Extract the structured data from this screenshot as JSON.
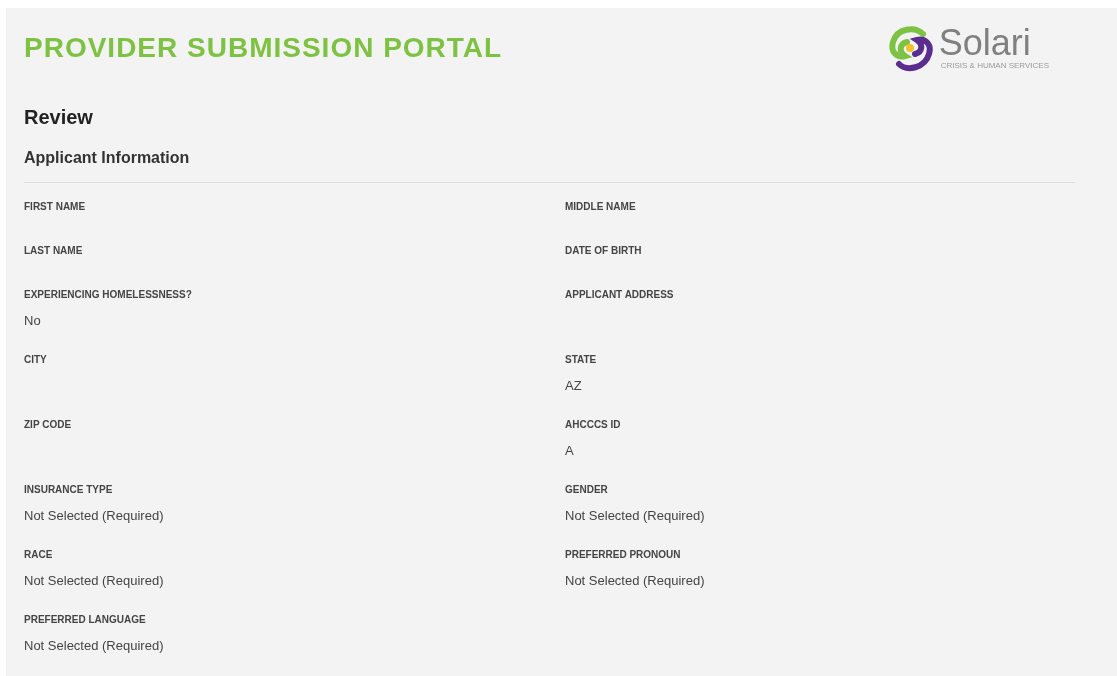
{
  "header": {
    "title": "PROVIDER SUBMISSION PORTAL",
    "logo": {
      "name": "Solari",
      "tagline": "CRISIS & HUMAN SERVICES"
    }
  },
  "page_title": "Review",
  "section": {
    "title": "Applicant Information",
    "rows": [
      [
        {
          "label": "FIRST NAME"
        },
        {
          "label": "MIDDLE NAME"
        }
      ],
      [
        {
          "label": "LAST NAME"
        },
        {
          "label": "DATE OF BIRTH"
        }
      ],
      [
        {
          "label": "EXPERIENCING HOMELESSNESS?",
          "value": "No"
        },
        {
          "label": "APPLICANT ADDRESS"
        }
      ],
      [
        {
          "label": "CITY"
        },
        {
          "label": "STATE",
          "value": "AZ"
        }
      ],
      [
        {
          "label": "ZIP CODE"
        },
        {
          "label": "AHCCCS ID",
          "value": "A"
        }
      ],
      [
        {
          "label": "INSURANCE TYPE",
          "value": "Not Selected (Required)"
        },
        {
          "label": "GENDER",
          "value": "Not Selected (Required)"
        }
      ],
      [
        {
          "label": "RACE",
          "value": "Not Selected (Required)"
        },
        {
          "label": "PREFERRED PRONOUN",
          "value": "Not Selected (Required)"
        }
      ],
      [
        {
          "label": "PREFERRED LANGUAGE",
          "value": "Not Selected (Required)"
        }
      ]
    ]
  }
}
